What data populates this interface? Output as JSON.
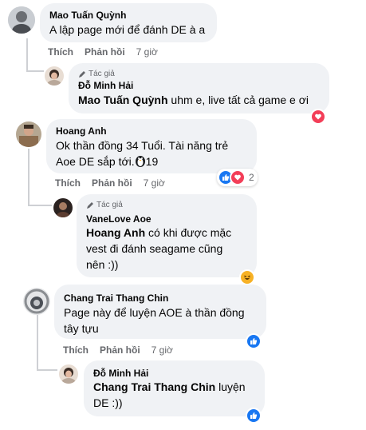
{
  "comments": [
    {
      "author": "Mao Tuấn Quỳnh",
      "text": "A lập page mới để đánh DE à a",
      "like": "Thích",
      "reply": "Phản hồi",
      "time": "7 giờ"
    },
    {
      "badge": "Tác giả",
      "author": "Đỗ Minh Hải",
      "mention": "Mao Tuấn Quỳnh",
      "text": " uhm e, live tất cả game e ơi"
    },
    {
      "author": "Hoang Anh",
      "line1": "Ok thần đồng 34 Tuổi. Tài năng trẻ",
      "line2": "Aoe DE sắp tới.",
      "num": "19",
      "reaction_count": "2",
      "like": "Thích",
      "reply": "Phản hồi",
      "time": "7 giờ"
    },
    {
      "badge": "Tác giả",
      "author": "VaneLove Aoe",
      "mention": "Hoang Anh",
      "text1": " có khi được mặc",
      "line2": "vest đi đánh seagame cũng",
      "line3": "nên :))"
    },
    {
      "author": "Chang Trai Thang Chin",
      "line1": "Page này để luyện AOE à thần đồng",
      "line2": "tây tựu",
      "like": "Thích",
      "reply": "Phản hồi",
      "time": "7 giờ"
    },
    {
      "author": "Đỗ Minh Hải",
      "mention": "Chang Trai Thang Chin",
      "text1": " luyện",
      "line2": "DE :))"
    }
  ],
  "colors": {
    "like_blue": "#1877f2",
    "love_red": "#f33e58",
    "haha_yellow": "#f7b125",
    "bubble": "#f0f2f5",
    "meta": "#65676b"
  }
}
